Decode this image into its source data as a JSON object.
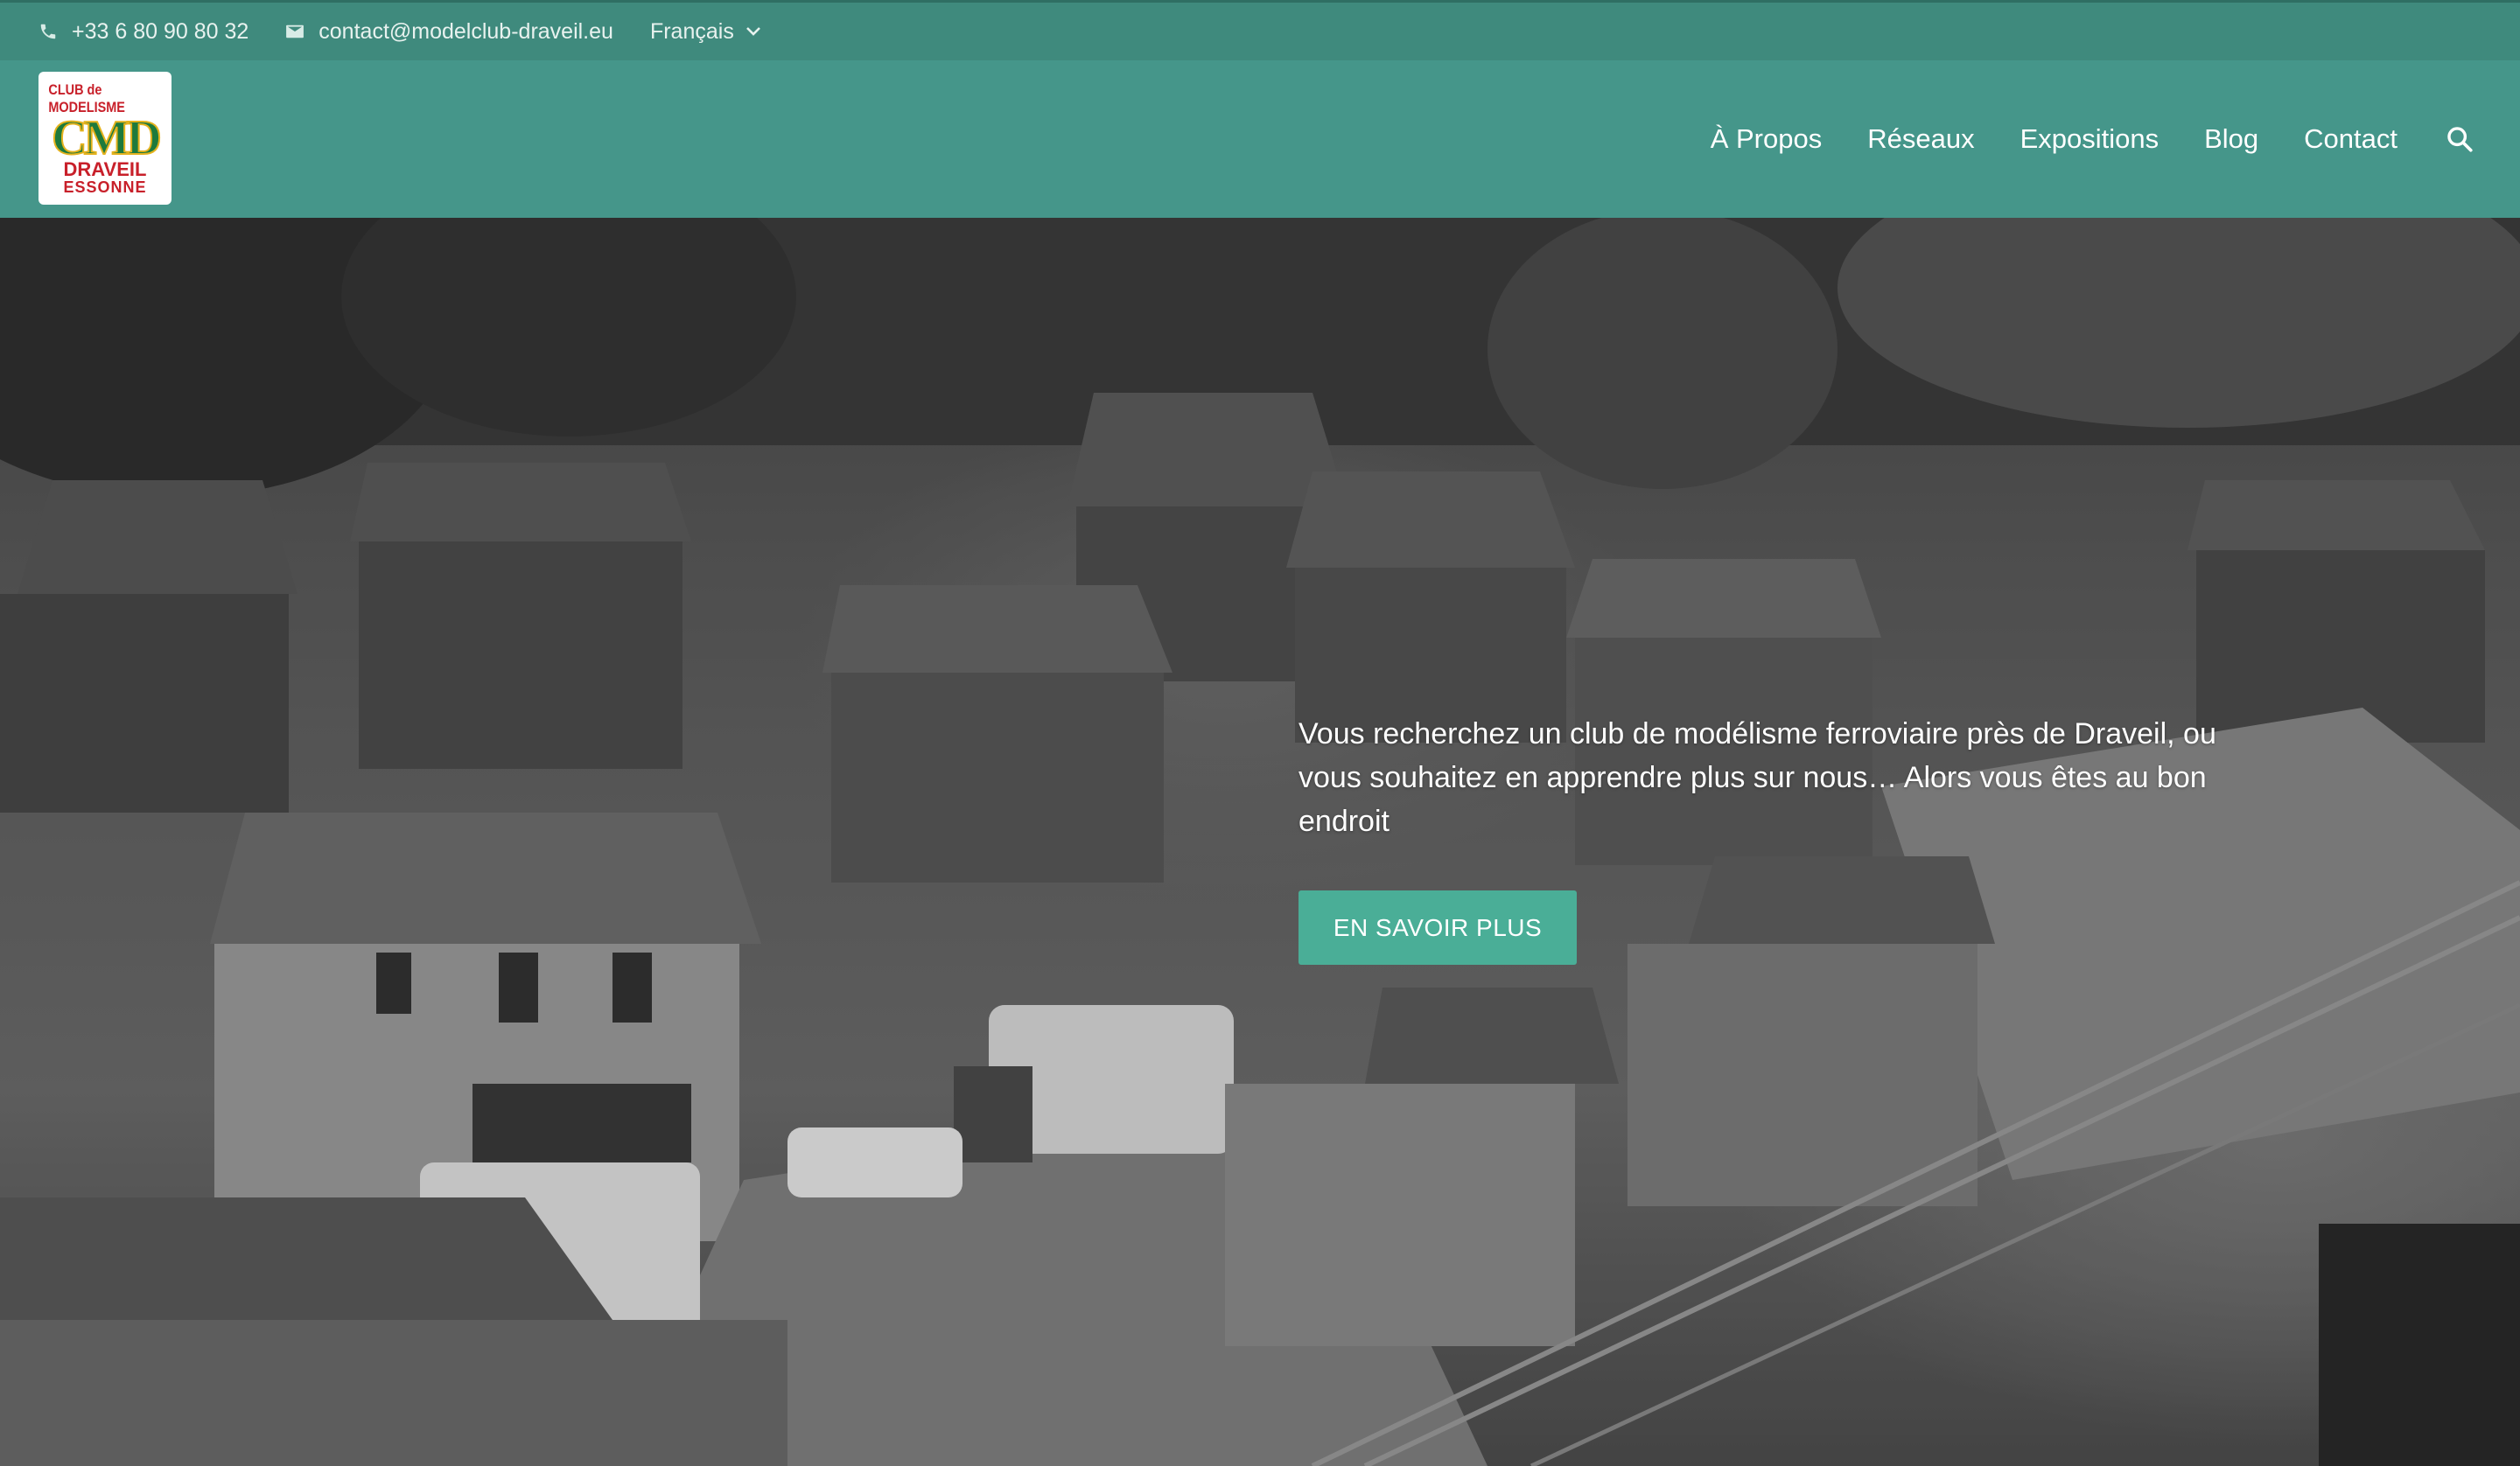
{
  "topbar": {
    "phone": "+33 6 80 90 80 32",
    "email": "contact@modelclub-draveil.eu",
    "language": "Français"
  },
  "logo": {
    "line_top": "CLUB de MODELISME",
    "monogram": "CMD",
    "line_1": "DRAVEIL",
    "line_2": "ESSONNE"
  },
  "nav": {
    "items": [
      "À Propos",
      "Réseaux",
      "Expositions",
      "Blog",
      "Contact"
    ]
  },
  "hero": {
    "text": "Vous recherchez un club de modélisme ferroviaire près de Draveil, ou vous souhaitez en apprendre plus sur nous… Alors vous êtes au bon endroit",
    "button": "EN SAVOIR PLUS"
  },
  "colors": {
    "topbar": "#3f8a7d",
    "header": "#45968a",
    "button": "#4aae97"
  }
}
